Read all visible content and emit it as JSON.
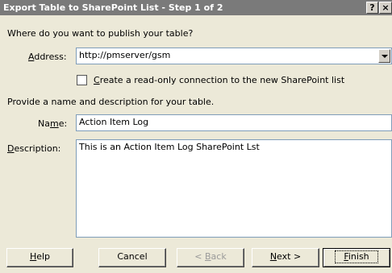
{
  "window": {
    "title": "Export Table to SharePoint List - Step 1 of 2",
    "help_glyph": "?",
    "close_glyph": "×"
  },
  "publish": {
    "question": "Where do you want to publish your table?",
    "address_label_underlined": "A",
    "address_label_rest": "ddress:",
    "address_value": "http://pmserver/gsm"
  },
  "readonly": {
    "checked": false,
    "label_underlined": "C",
    "label_rest": "reate a read-only connection to the new SharePoint list"
  },
  "details": {
    "instruction": "Provide a name and description for your table.",
    "name_label_before": "Na",
    "name_label_underlined": "m",
    "name_label_after": "e:",
    "name_value": "Action Item Log",
    "description_label_underlined": "D",
    "description_label_rest": "escription:",
    "description_value": "This is an Action Item Log SharePoint Lst"
  },
  "buttons": {
    "help_underlined": "H",
    "help_rest": "elp",
    "cancel": "Cancel",
    "back_prefix": "< ",
    "back_underlined": "B",
    "back_rest": "ack",
    "next_underlined": "N",
    "next_rest": "ext >",
    "finish_underlined": "F",
    "finish_rest": "inish"
  }
}
